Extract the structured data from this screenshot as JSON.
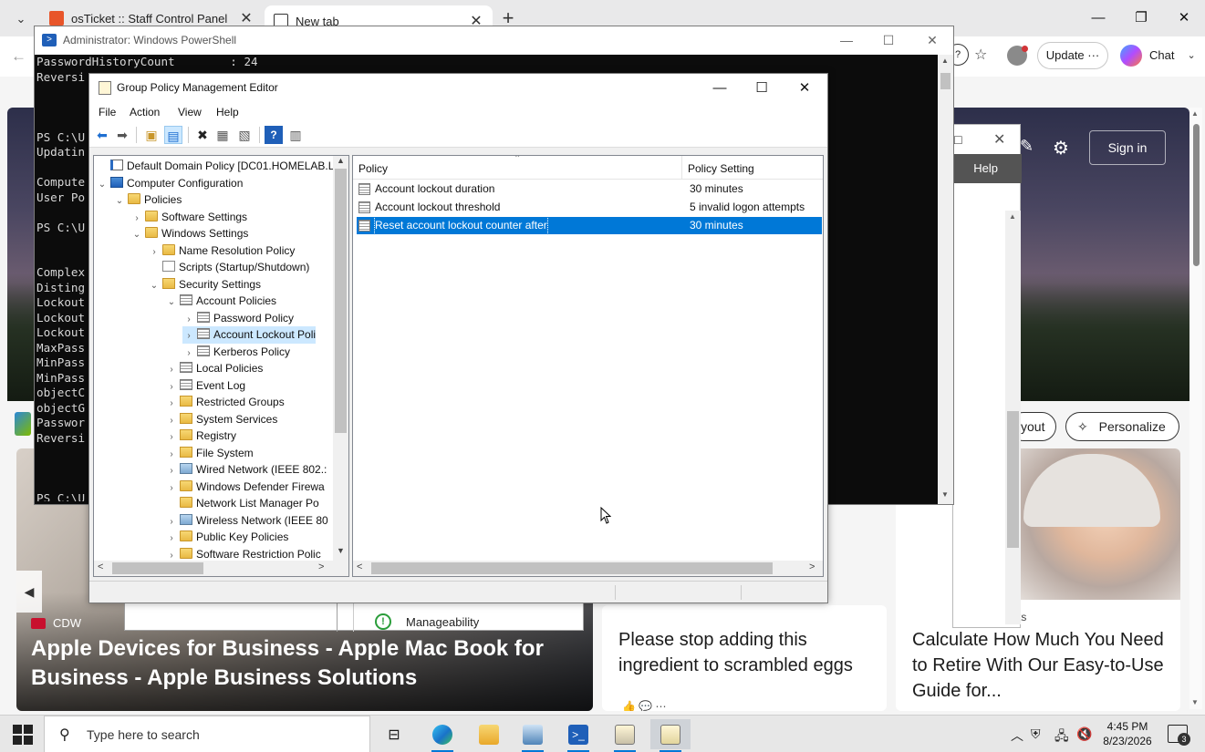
{
  "browser": {
    "tabs": [
      {
        "title": "osTicket :: Staff Control Panel"
      },
      {
        "title": "New tab"
      }
    ],
    "update_label": "Update",
    "chat_label": "Chat"
  },
  "msn": {
    "signin_label": "Sign in",
    "help_label": "Help",
    "layout_label": "yout",
    "personalize_label": "Personalize",
    "card_big": {
      "source": "CDW",
      "headline": "Apple Devices for Business - Apple Mac Book for Business - Apple Business Solutions"
    },
    "card_mid": {
      "headline": "Please stop adding this ingredient to scrambled eggs"
    },
    "card_right": {
      "source": "ts",
      "headline": "Calculate How Much You Need to Retire With Our Easy-to-Use Guide for..."
    }
  },
  "underlying": {
    "manageability_label": "Manageability"
  },
  "powershell": {
    "title": "Administrator: Windows PowerShell",
    "lines": [
      "PasswordHistoryCount        : 24",
      "Reversi",
      "",
      "",
      "",
      "PS C:\\U",
      "Updatin",
      "",
      "Compute",
      "User Po",
      "",
      "PS C:\\U",
      "",
      "",
      "Complex",
      "Disting",
      "Lockout",
      "Lockout",
      "Lockout",
      "MaxPass",
      "MinPass",
      "MinPass",
      "objectC",
      "objectG",
      "Passwor",
      "Reversi",
      "",
      "",
      "",
      "PS C:\\U"
    ]
  },
  "gpme": {
    "title": "Group Policy Management Editor",
    "menu": [
      "File",
      "Action",
      "View",
      "Help"
    ],
    "tree": [
      {
        "label": "Default Domain Policy [DC01.HOMELAB.LC",
        "depth": 0,
        "chev": "",
        "icon": "gpo"
      },
      {
        "label": "Computer Configuration",
        "depth": 0,
        "chev": "v",
        "icon": "comp"
      },
      {
        "label": "Policies",
        "depth": 1,
        "chev": "v",
        "icon": "folder"
      },
      {
        "label": "Software Settings",
        "depth": 2,
        "chev": ">",
        "icon": "folder"
      },
      {
        "label": "Windows Settings",
        "depth": 2,
        "chev": "v",
        "icon": "folder"
      },
      {
        "label": "Name Resolution Policy",
        "depth": 3,
        "chev": ">",
        "icon": "folder"
      },
      {
        "label": "Scripts (Startup/Shutdown)",
        "depth": 3,
        "chev": "",
        "icon": "doc"
      },
      {
        "label": "Security Settings",
        "depth": 3,
        "chev": "v",
        "icon": "lock"
      },
      {
        "label": "Account Policies",
        "depth": 4,
        "chev": "v",
        "icon": "policy"
      },
      {
        "label": "Password Policy",
        "depth": 5,
        "chev": ">",
        "icon": "policy"
      },
      {
        "label": "Account Lockout Poli",
        "depth": 5,
        "chev": ">",
        "icon": "policy",
        "selected": true
      },
      {
        "label": "Kerberos Policy",
        "depth": 5,
        "chev": ">",
        "icon": "policy"
      },
      {
        "label": "Local Policies",
        "depth": 4,
        "chev": ">",
        "icon": "policy"
      },
      {
        "label": "Event Log",
        "depth": 4,
        "chev": ">",
        "icon": "policy"
      },
      {
        "label": "Restricted Groups",
        "depth": 4,
        "chev": ">",
        "icon": "lock"
      },
      {
        "label": "System Services",
        "depth": 4,
        "chev": ">",
        "icon": "lock"
      },
      {
        "label": "Registry",
        "depth": 4,
        "chev": ">",
        "icon": "lock"
      },
      {
        "label": "File System",
        "depth": 4,
        "chev": ">",
        "icon": "lock"
      },
      {
        "label": "Wired Network (IEEE 802.:",
        "depth": 4,
        "chev": ">",
        "icon": "net"
      },
      {
        "label": "Windows Defender Firewa",
        "depth": 4,
        "chev": ">",
        "icon": "folder"
      },
      {
        "label": "Network List Manager Po",
        "depth": 4,
        "chev": "",
        "icon": "folder"
      },
      {
        "label": "Wireless Network (IEEE 80",
        "depth": 4,
        "chev": ">",
        "icon": "net"
      },
      {
        "label": "Public Key Policies",
        "depth": 4,
        "chev": ">",
        "icon": "folder"
      },
      {
        "label": "Software Restriction Polic",
        "depth": 4,
        "chev": ">",
        "icon": "folder"
      }
    ],
    "list_headers": {
      "policy": "Policy",
      "setting": "Policy Setting"
    },
    "policies": [
      {
        "name": "Account lockout duration",
        "setting": "30 minutes"
      },
      {
        "name": "Account lockout threshold",
        "setting": "5 invalid logon attempts"
      },
      {
        "name": "Reset account lockout counter after",
        "setting": "30 minutes",
        "selected": true
      }
    ]
  },
  "taskbar": {
    "search_placeholder": "Type here to search",
    "time": "4:45 PM",
    "date": "8/23/2026",
    "notification_count": "3"
  }
}
